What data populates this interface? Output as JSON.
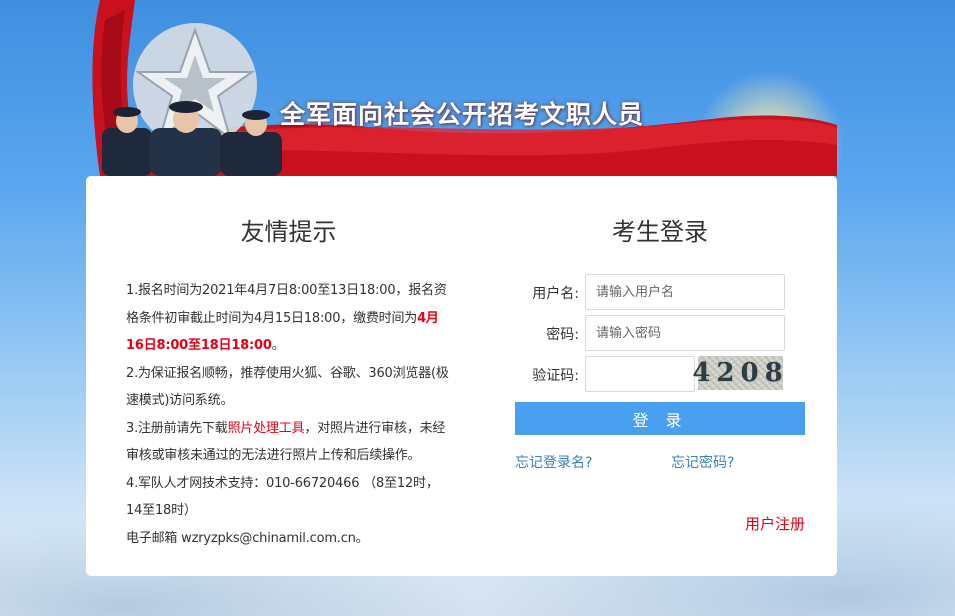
{
  "header": {
    "title": "全军面向社会公开招考文职人员"
  },
  "notice": {
    "title": "友情提示",
    "item1_prefix": "1.报名时间为2021年4月7日8:00至13日18:00，报名资格条件初审截止时间为4月15日18:00，缴费时间为",
    "item1_highlight": "4月16日8:00至18日18:00",
    "item1_suffix": "。",
    "item2": "2.为保证报名顺畅，推荐使用火狐、谷歌、360浏览器(极速模式)访问系统。",
    "item3_prefix": "3.注册前请先下载",
    "item3_link": "照片处理工具",
    "item3_suffix": "，对照片进行审核，未经审核或审核未通过的无法进行照片上传和后续操作。",
    "item4": "4.军队人才网技术支持：010-66720466 （8至12时，14至18时）",
    "email": "电子邮箱 wzryzpks@chinamil.com.cn。"
  },
  "login": {
    "title": "考生登录",
    "username_label": "用户名:",
    "username_placeholder": "请输入用户名",
    "password_label": "密码:",
    "password_placeholder": "请输入密码",
    "captcha_label": "验证码:",
    "captcha_text": "4208",
    "login_button": "登 录",
    "forgot_username": "忘记登录名?",
    "forgot_password": "忘记密码?",
    "register": "用户注册"
  },
  "colors": {
    "accent_blue": "#4aa0f0",
    "link_blue": "#3b7fc4",
    "alert_red": "#e60012"
  }
}
